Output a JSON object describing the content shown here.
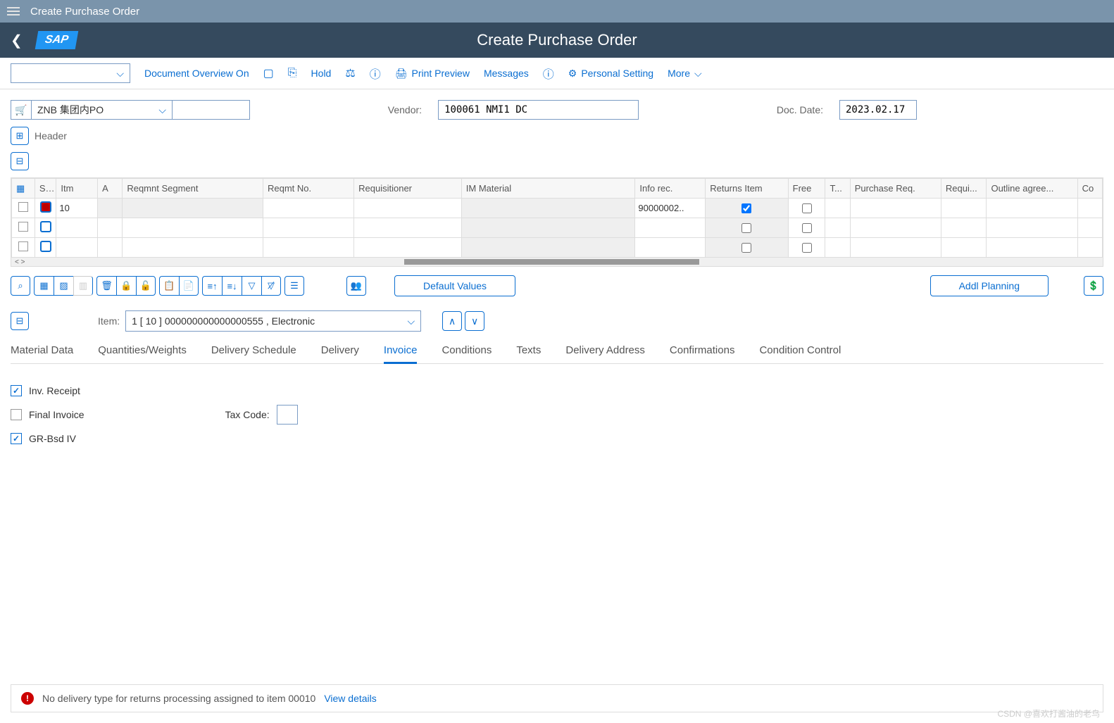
{
  "top_nav": {
    "title": "Create Purchase Order"
  },
  "header": {
    "title": "Create Purchase Order",
    "logo": "SAP"
  },
  "toolbar": {
    "doc_overview": "Document Overview On",
    "hold": "Hold",
    "print_preview": "Print Preview",
    "messages": "Messages",
    "personal_setting": "Personal Setting",
    "more": "More"
  },
  "po_type": {
    "value": "ZNB 集团内PO"
  },
  "vendor": {
    "label": "Vendor:",
    "value": "100061 NMI1 DC"
  },
  "doc_date": {
    "label": "Doc. Date:",
    "value": "2023.02.17"
  },
  "header_section": {
    "label": "Header"
  },
  "item_table": {
    "columns": {
      "s": "S...",
      "itm": "Itm",
      "a": "A",
      "reqmnt_segment": "Reqmnt Segment",
      "reqmt_no": "Reqmt No.",
      "requisitioner": "Requisitioner",
      "im_material": "IM Material",
      "info_rec": "Info rec.",
      "returns_item": "Returns Item",
      "free": "Free",
      "t": "T...",
      "purchase_req": "Purchase Req.",
      "requi": "Requi...",
      "outline_agree": "Outline agree...",
      "co": "Co"
    },
    "rows": [
      {
        "itm": "10",
        "status": "red",
        "info_rec": "90000002..",
        "returns_checked": true,
        "free_checked": false
      },
      {
        "itm": "",
        "status": "empty",
        "info_rec": "",
        "returns_checked": false,
        "free_checked": false
      },
      {
        "itm": "",
        "status": "empty",
        "info_rec": "",
        "returns_checked": false,
        "free_checked": false
      }
    ]
  },
  "action_buttons": {
    "default_values": "Default Values",
    "addl_planning": "Addl Planning"
  },
  "item_detail": {
    "label": "Item:",
    "value": "1 [ 10 ] 000000000000000555 , Electronic"
  },
  "tabs": {
    "material_data": "Material Data",
    "quantities": "Quantities/Weights",
    "delivery_schedule": "Delivery Schedule",
    "delivery": "Delivery",
    "invoice": "Invoice",
    "conditions": "Conditions",
    "texts": "Texts",
    "delivery_address": "Delivery Address",
    "confirmations": "Confirmations",
    "condition_control": "Condition Control"
  },
  "invoice_tab": {
    "inv_receipt": {
      "label": "Inv. Receipt",
      "checked": true
    },
    "final_invoice": {
      "label": "Final Invoice",
      "checked": false
    },
    "gr_bsd_iv": {
      "label": "GR-Bsd IV",
      "checked": true
    },
    "tax_code": {
      "label": "Tax Code:",
      "value": ""
    }
  },
  "status_bar": {
    "message": "No delivery type for returns processing assigned to item 00010",
    "view_details": "View details"
  },
  "watermark": "CSDN @喜欢打酱油的老鸟"
}
